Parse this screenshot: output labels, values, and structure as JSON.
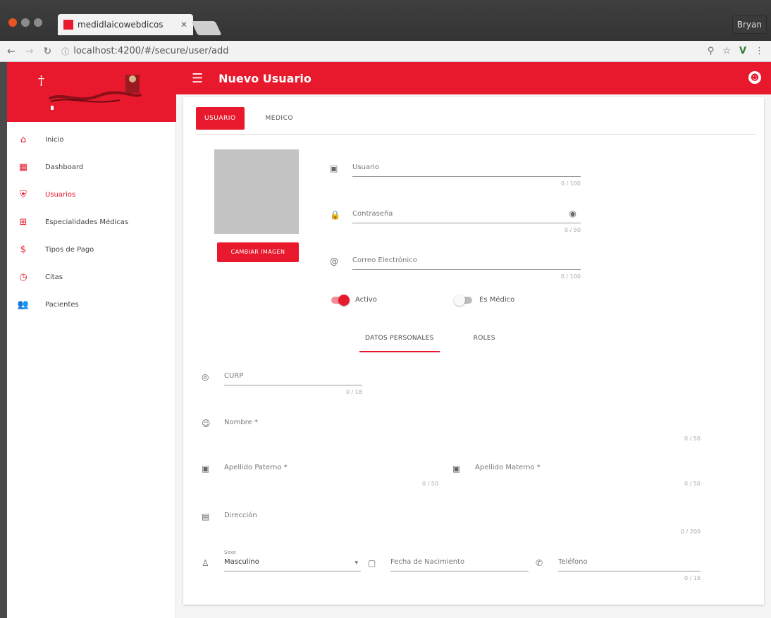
{
  "browser": {
    "tab_title": "medidlaicowebdicos",
    "url": "localhost:4200/#/secure/user/add",
    "user": "Bryan"
  },
  "sidebar": {
    "items": [
      {
        "label": "Inicio",
        "icon": "home-icon"
      },
      {
        "label": "Dashboard",
        "icon": "dashboard-icon"
      },
      {
        "label": "Usuarios",
        "icon": "shield-icon"
      },
      {
        "label": "Especialidades Médicas",
        "icon": "medical-plus-icon"
      },
      {
        "label": "Tipos de Pago",
        "icon": "dollar-icon"
      },
      {
        "label": "Citas",
        "icon": "clock-icon"
      },
      {
        "label": "Pacientes",
        "icon": "people-icon"
      }
    ]
  },
  "header": {
    "title": "Nuevo Usuario"
  },
  "card": {
    "tabs": [
      "USUARIO",
      "MÉDICO"
    ],
    "change_image_label": "CAMBIAR IMAGEN",
    "username_label": "Usuario",
    "username_hint": "0 / 100",
    "password_label": "Contraseña",
    "password_hint": "0 / 50",
    "email_label": "Correo Electrónico",
    "email_hint": "0 / 100",
    "active_label": "Activo",
    "is_doctor_label": "Es Médico",
    "subtabs": [
      "DATOS PERSONALES",
      "ROLES"
    ],
    "curp_label": "CURP",
    "curp_hint": "0 / 18",
    "name_label": "Nombre *",
    "name_hint": "0 / 50",
    "paternal_label": "Apellido Paterno *",
    "paternal_hint": "0 / 50",
    "maternal_label": "Apellido Materno *",
    "maternal_hint": "0 / 50",
    "address_label": "Dirección",
    "address_hint": "0 / 200",
    "gender_small_label": "Sexo",
    "gender_value": "Masculino",
    "birthdate_label": "Fecha de Nacimiento",
    "phone_label": "Teléfono",
    "phone_hint": "0 / 15"
  },
  "colors": {
    "accent": "#e8192c"
  }
}
